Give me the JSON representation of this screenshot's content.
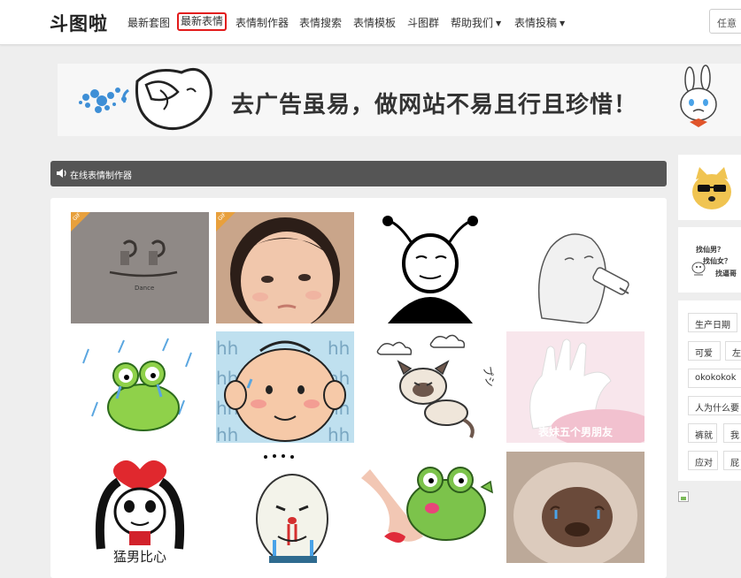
{
  "header": {
    "logo": "斗图啦",
    "nav": [
      {
        "label": "最新套图"
      },
      {
        "label": "最新表情"
      },
      {
        "label": "表情制作器"
      },
      {
        "label": "表情搜索"
      },
      {
        "label": "表情模板"
      },
      {
        "label": "斗图群"
      },
      {
        "label": "帮助我们"
      },
      {
        "label": "表情投稿"
      }
    ],
    "search_text": "任意"
  },
  "banner": {
    "text": "去广告虽易，做网站不易且行且珍惜！"
  },
  "section": {
    "title": "在线表情制作器"
  },
  "grid": {
    "badge": "GIF",
    "captions": [
      "Dance",
      "猛男比心",
      "表妹五个男朋友"
    ]
  },
  "sidebar": {
    "promo_lines": [
      "找仙男？",
      "找仙女？",
      "找逼哥"
    ],
    "tags": [
      "生产日期",
      "可爱",
      "左",
      "okokokok",
      "人为什么要",
      "裤就",
      "我",
      "应对",
      "屁"
    ]
  },
  "colors": {
    "active_nav_border": "#e21b1b",
    "section_header_bg": "#555555",
    "gif_badge": "#e8a03c"
  }
}
